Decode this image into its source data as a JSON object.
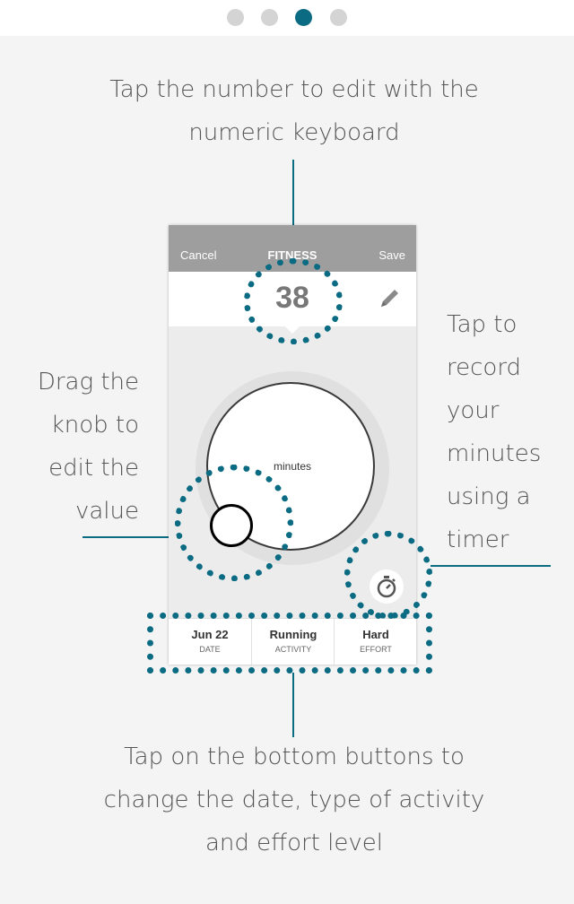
{
  "pager": {
    "dots": [
      {
        "state": "inactive"
      },
      {
        "state": "inactive"
      },
      {
        "state": "active"
      },
      {
        "state": "inactive"
      }
    ],
    "active_color": "#0a6b82",
    "inactive_color": "#d4d4d4"
  },
  "annotations": {
    "top": [
      "Tap the number to edit with the",
      "numeric keyboard"
    ],
    "left": [
      "Drag the",
      "knob to",
      "edit  the",
      "value"
    ],
    "right": [
      "Tap to",
      "record",
      "your",
      "minutes",
      "using a",
      "timer"
    ],
    "bottom": [
      "Tap on the bottom buttons to",
      "change the date, type of activity",
      "and effort level"
    ]
  },
  "app": {
    "cancel_label": "Cancel",
    "title": "FITNESS",
    "save_label": "Save",
    "minutes_value": "38",
    "dial_label": "minutes",
    "bottom_buttons": [
      {
        "value": "Jun 22",
        "caption": "DATE"
      },
      {
        "value": "Running",
        "caption": "ACTIVITY"
      },
      {
        "value": "Hard",
        "caption": "EFFORT"
      }
    ]
  },
  "icons": {
    "edit": "pencil-icon",
    "timer": "stopwatch-icon"
  },
  "colors": {
    "highlight": "#0a6b82",
    "navbar": "#9e9e9e"
  }
}
